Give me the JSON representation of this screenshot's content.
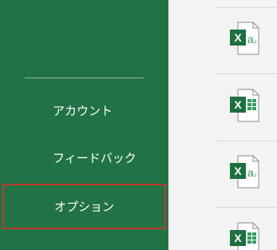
{
  "sidebar": {
    "items": [
      {
        "label": "アカウント"
      },
      {
        "label": "フィードバック"
      },
      {
        "label": "オプション"
      }
    ]
  },
  "recent_files": [
    {
      "icon": "excel-addin-file-icon"
    },
    {
      "icon": "excel-workbook-file-icon"
    },
    {
      "icon": "excel-addin-file-icon"
    },
    {
      "icon": "excel-workbook-file-icon"
    }
  ],
  "colors": {
    "sidebar_bg": "#217346",
    "selection_border": "#c0392b",
    "excel_green": "#1e6f3f"
  }
}
